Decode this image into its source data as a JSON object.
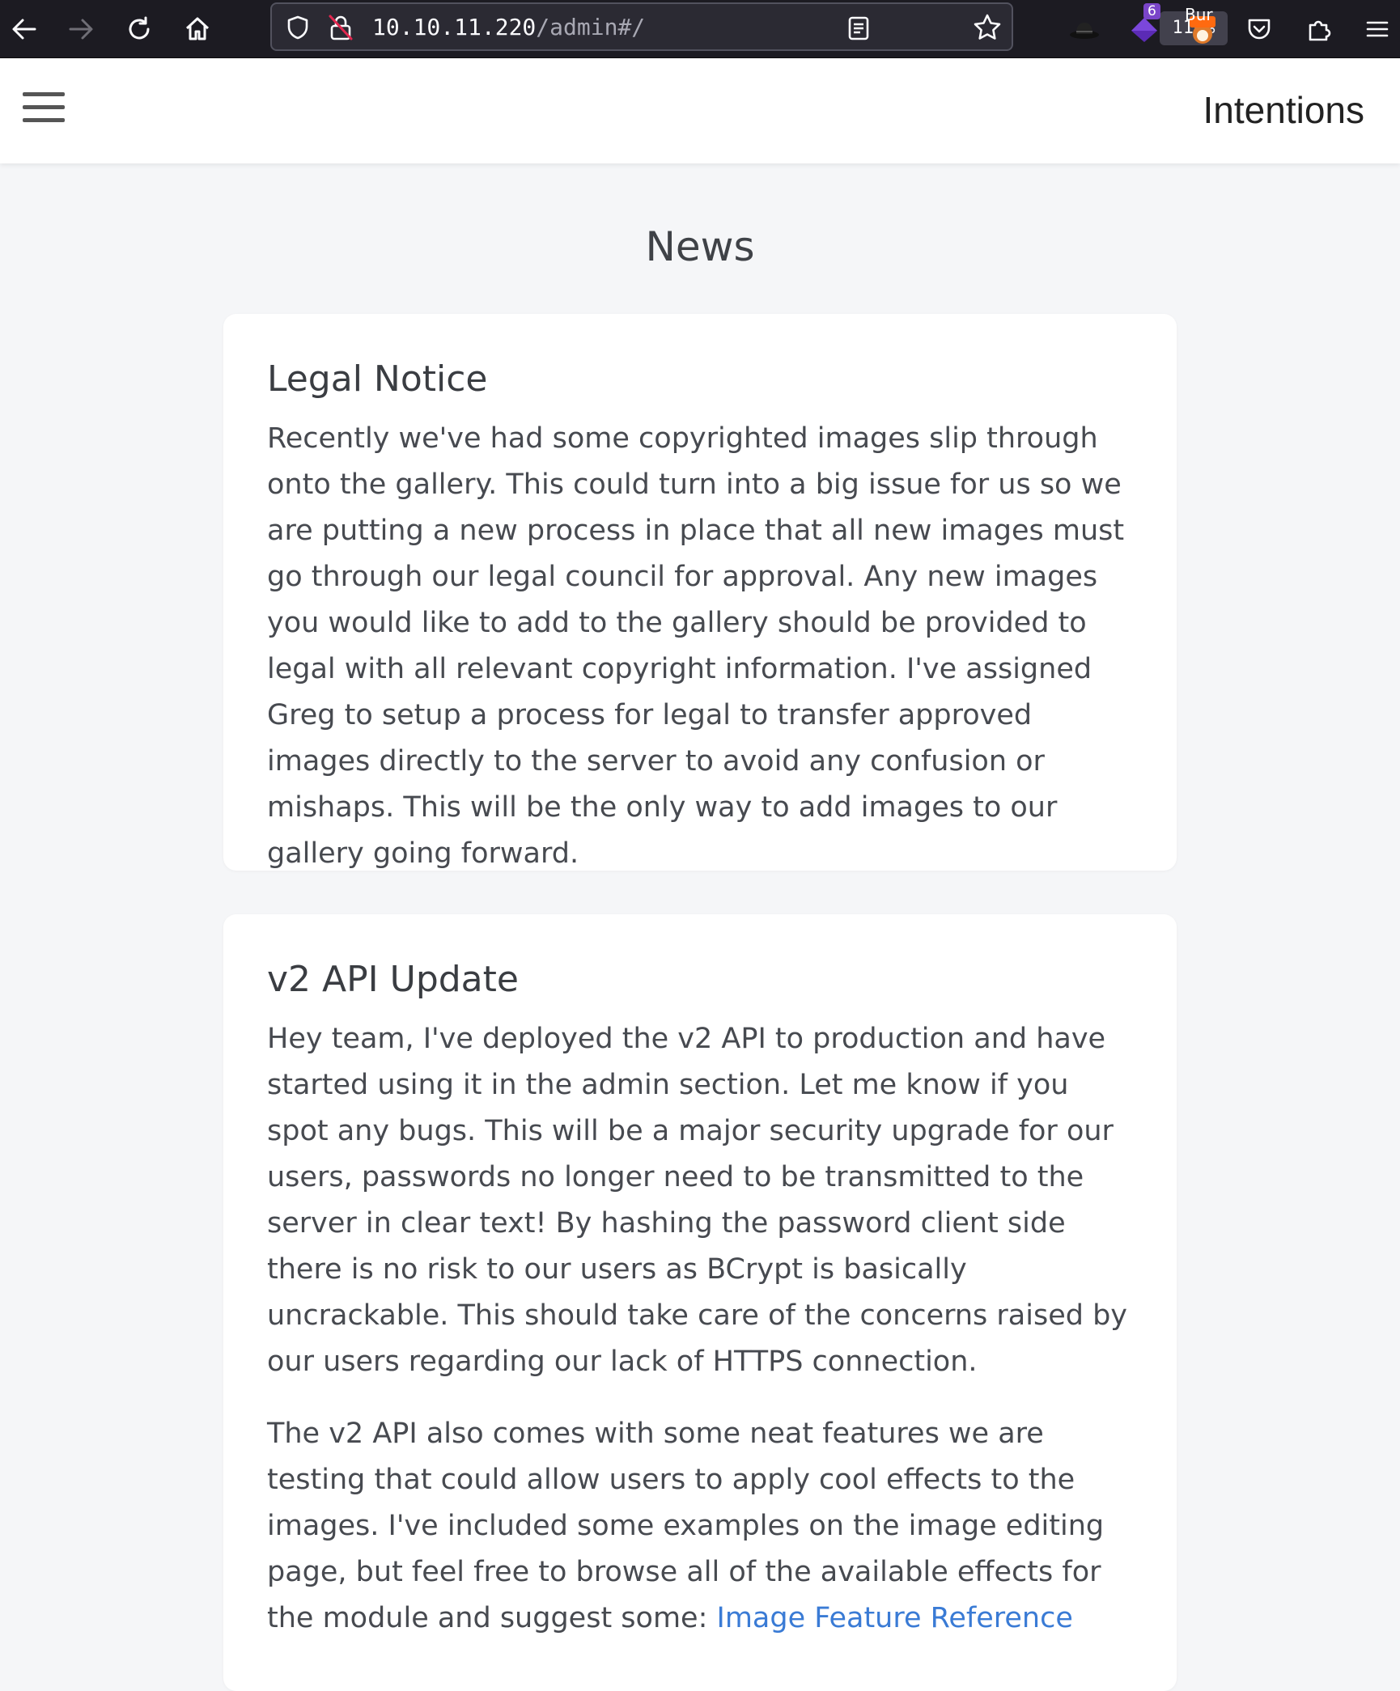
{
  "browser": {
    "url_host": "10.10.11.220",
    "url_path": "/admin#/",
    "zoom": "110%",
    "extension_badge": "6",
    "burp_label": "Bur"
  },
  "header": {
    "brand": "Intentions"
  },
  "main": {
    "title": "News",
    "articles": [
      {
        "title": "Legal Notice",
        "paragraphs": [
          "Recently we've had some copyrighted images slip through onto the gallery. This could turn into a big issue for us so we are putting a new process in place that all new images must go through our legal council for approval. Any new images you would like to add to the gallery should be provided to legal with all relevant copyright information. I've assigned Greg to setup a process for legal to transfer approved images directly to the server to avoid any confusion or mishaps. This will be the only way to add images to our gallery going forward."
        ]
      },
      {
        "title": "v2 API Update",
        "paragraphs": [
          "Hey team, I've deployed the v2 API to production and have started using it in the admin section. Let me know if you spot any bugs. This will be a major security upgrade for our users, passwords no longer need to be transmitted to the server in clear text! By hashing the password client side there is no risk to our users as BCrypt is basically uncrackable. This should take care of the concerns raised by our users regarding our lack of HTTPS connection.",
          "The v2 API also comes with some neat features we are testing that could allow users to apply cool effects to the images. I've included some examples on the image editing page, but feel free to browse all of the available effects for the module and suggest some: "
        ],
        "link_text": "Image Feature Reference"
      }
    ]
  }
}
